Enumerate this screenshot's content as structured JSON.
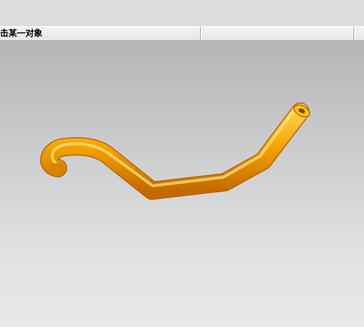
{
  "statusbar": {
    "prompt": "击某一对象"
  },
  "model": {
    "name": "pipe-model",
    "color_main": "#f5a300",
    "color_highlight": "#ffd24a",
    "color_shadow": "#c26a00",
    "color_bore": "#7a4a00"
  }
}
